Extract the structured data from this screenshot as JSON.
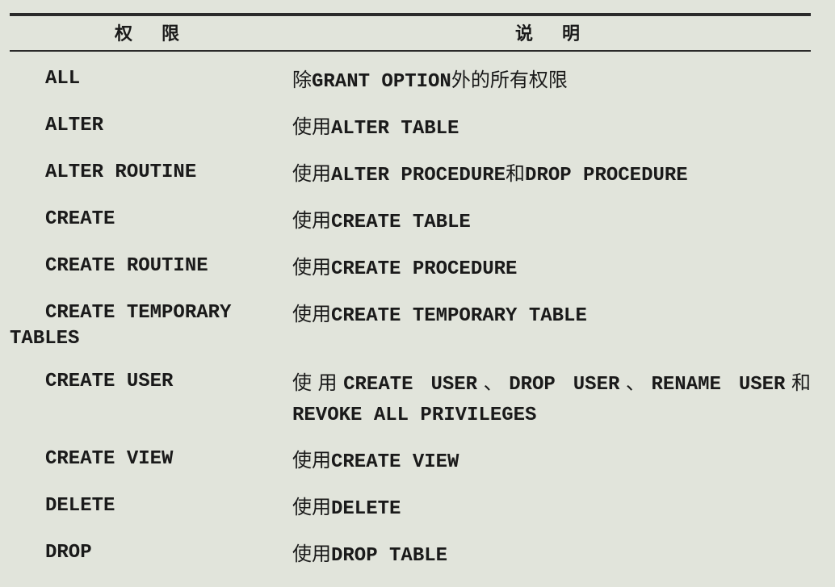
{
  "chart_data": {
    "type": "table",
    "columns": [
      "权限",
      "说明"
    ],
    "rows": [
      [
        "ALL",
        "除GRANT OPTION外的所有权限"
      ],
      [
        "ALTER",
        "使用ALTER TABLE"
      ],
      [
        "ALTER ROUTINE",
        "使用ALTER PROCEDURE和DROP PROCEDURE"
      ],
      [
        "CREATE",
        "使用CREATE TABLE"
      ],
      [
        "CREATE ROUTINE",
        "使用CREATE PROCEDURE"
      ],
      [
        "CREATE TEMPORARY TABLES",
        "使用CREATE TEMPORARY TABLE"
      ],
      [
        "CREATE USER",
        "使用CREATE USER、DROP USER、RENAME USER和REVOKE ALL PRIVILEGES"
      ],
      [
        "CREATE VIEW",
        "使用CREATE VIEW"
      ],
      [
        "DELETE",
        "使用DELETE"
      ],
      [
        "DROP",
        "使用DROP TABLE"
      ]
    ]
  },
  "headers": {
    "priv": "权限",
    "desc": "说明"
  },
  "rows": [
    {
      "priv": "ALL",
      "desc_pre": "除",
      "desc_mono": "GRANT OPTION",
      "desc_mid": "外的所有权限",
      "desc_mono2": "",
      "desc_tail": ""
    },
    {
      "priv": "ALTER",
      "desc_pre": "使用",
      "desc_mono": "ALTER TABLE",
      "desc_mid": "",
      "desc_mono2": "",
      "desc_tail": ""
    },
    {
      "priv": "ALTER ROUTINE",
      "desc_pre": "使用",
      "desc_mono": "ALTER PROCEDURE",
      "desc_mid": "和",
      "desc_mono2": "DROP PROCEDURE",
      "desc_tail": ""
    },
    {
      "priv": "CREATE",
      "desc_pre": "使用",
      "desc_mono": "CREATE TABLE",
      "desc_mid": "",
      "desc_mono2": "",
      "desc_tail": ""
    },
    {
      "priv": "CREATE ROUTINE",
      "desc_pre": "使用",
      "desc_mono": "CREATE PROCEDURE",
      "desc_mid": "",
      "desc_mono2": "",
      "desc_tail": ""
    },
    {
      "priv_line1": "CREATE TEMPORARY",
      "priv_line2": "TABLES",
      "desc_pre": "使用",
      "desc_mono": "CREATE TEMPORARY TABLE",
      "desc_mid": "",
      "desc_mono2": "",
      "desc_tail": ""
    },
    {
      "priv": "CREATE USER",
      "desc_pre": "使用",
      "desc_mono": "CREATE USER",
      "desc_mid": "、",
      "desc_mono2": "DROP USER",
      "desc_mid2": "、",
      "desc_mono3": "RENAME USER",
      "desc_mid3": "和",
      "desc_mono4": "REVOKE ALL PRIVILEGES",
      "desc_tail": ""
    },
    {
      "priv": "CREATE VIEW",
      "desc_pre": "使用",
      "desc_mono": "CREATE VIEW",
      "desc_mid": "",
      "desc_mono2": "",
      "desc_tail": ""
    },
    {
      "priv": "DELETE",
      "desc_pre": "使用",
      "desc_mono": "DELETE",
      "desc_mid": "",
      "desc_mono2": "",
      "desc_tail": ""
    },
    {
      "priv": "DROP",
      "desc_pre": "使用",
      "desc_mono": "DROP TABLE",
      "desc_mid": "",
      "desc_mono2": "",
      "desc_tail": ""
    }
  ]
}
